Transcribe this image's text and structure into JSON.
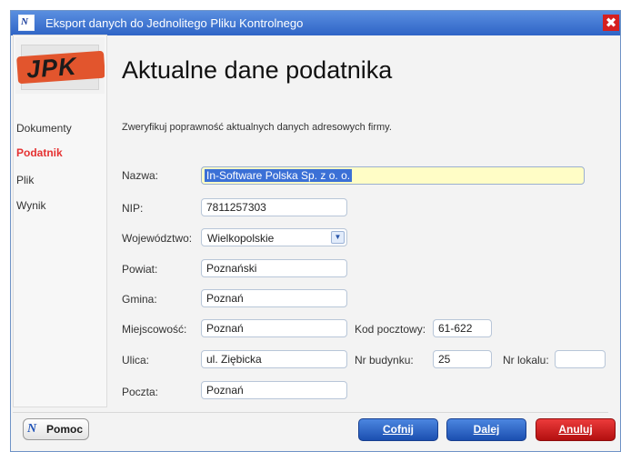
{
  "window": {
    "title": "Eksport danych do Jednolitego Pliku Kontrolnego",
    "close_glyph": "✖"
  },
  "logo": {
    "text": "JPK",
    "icon_glyph": "N"
  },
  "sidebar": {
    "items": [
      {
        "label": "Dokumenty",
        "active": false
      },
      {
        "label": "Podatnik",
        "active": true
      },
      {
        "label": "Plik",
        "active": false
      },
      {
        "label": "Wynik",
        "active": false
      }
    ]
  },
  "main": {
    "heading": "Aktualne dane podatnika",
    "instruction": "Zweryfikuj poprawność aktualnych danych adresowych firmy."
  },
  "form": {
    "nazwa": {
      "label": "Nazwa:",
      "value": "In-Software Polska Sp. z o. o."
    },
    "nip": {
      "label": "NIP:",
      "value": "7811257303"
    },
    "wojewodztwo": {
      "label": "Województwo:",
      "value": "Wielkopolskie"
    },
    "powiat": {
      "label": "Powiat:",
      "value": "Poznański"
    },
    "gmina": {
      "label": "Gmina:",
      "value": "Poznań"
    },
    "miejscowosc": {
      "label": "Miejscowość:",
      "value": "Poznań"
    },
    "kod": {
      "label": "Kod pocztowy:",
      "value": "61-622"
    },
    "ulica": {
      "label": "Ulica:",
      "value": "ul. Ziębicka"
    },
    "nr_budynku": {
      "label": "Nr budynku:",
      "value": "25"
    },
    "nr_lokalu": {
      "label": "Nr lokalu:",
      "value": ""
    },
    "poczta": {
      "label": "Poczta:",
      "value": "Poznań"
    }
  },
  "footer": {
    "help_label": "Pomoc",
    "help_icon_glyph": "N",
    "back_label": "Cofnij",
    "next_label": "Dalej",
    "cancel_label": "Anuluj"
  },
  "colors": {
    "active_nav": "#e53232",
    "title_bar": "#2f64c6",
    "primary_button": "#1b4fb0",
    "cancel_button": "#b30f0f",
    "focused_field": "#fffdc6"
  },
  "icons": {
    "app": "app-logo-icon",
    "close": "close-icon",
    "dropdown": "chevron-down-icon",
    "help": "help-icon"
  }
}
